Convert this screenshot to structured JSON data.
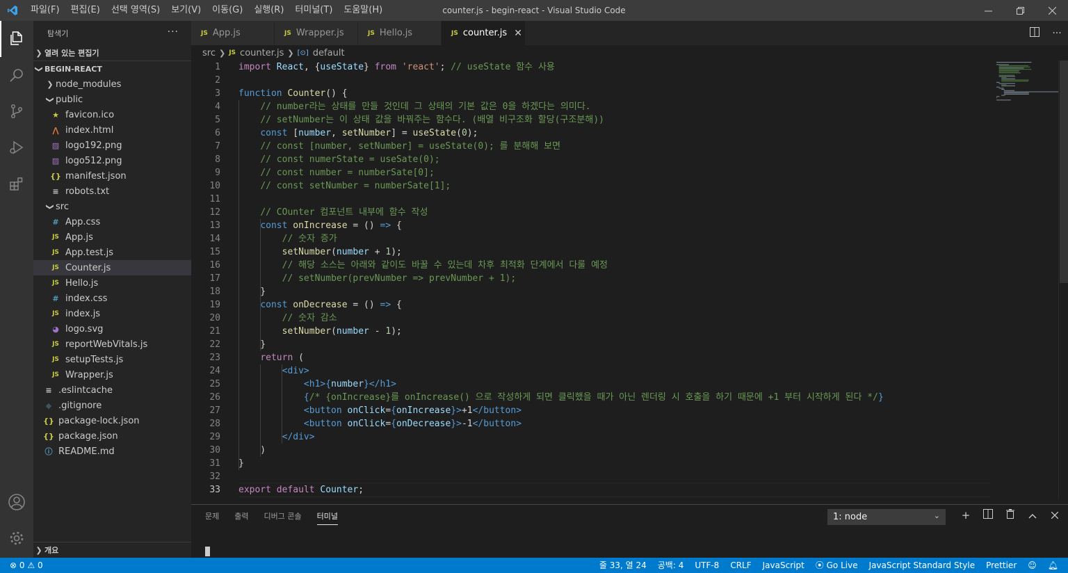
{
  "titlebar": {
    "menu": [
      "파일(F)",
      "편집(E)",
      "선택 영역(S)",
      "보기(V)",
      "이동(G)",
      "실행(R)",
      "터미널(T)",
      "도움말(H)"
    ],
    "title": "counter.js - begin-react - Visual Studio Code"
  },
  "sidebar": {
    "header": "탐색기",
    "open_editors": "열려 있는 편집기",
    "project": "BEGIN-REACT",
    "outline": "개요",
    "tree": [
      {
        "label": "node_modules",
        "type": "folder-closed",
        "depth": 1
      },
      {
        "label": "public",
        "type": "folder-open",
        "depth": 1
      },
      {
        "label": "favicon.ico",
        "type": "star",
        "depth": 2
      },
      {
        "label": "index.html",
        "type": "html",
        "depth": 2
      },
      {
        "label": "logo192.png",
        "type": "image",
        "depth": 2
      },
      {
        "label": "logo512.png",
        "type": "image",
        "depth": 2
      },
      {
        "label": "manifest.json",
        "type": "json",
        "depth": 2
      },
      {
        "label": "robots.txt",
        "type": "text",
        "depth": 2
      },
      {
        "label": "src",
        "type": "folder-open",
        "depth": 1
      },
      {
        "label": "App.css",
        "type": "css",
        "depth": 2
      },
      {
        "label": "App.js",
        "type": "js",
        "depth": 2
      },
      {
        "label": "App.test.js",
        "type": "js",
        "depth": 2
      },
      {
        "label": "Counter.js",
        "type": "js",
        "depth": 2,
        "selected": true
      },
      {
        "label": "Hello.js",
        "type": "js",
        "depth": 2
      },
      {
        "label": "index.css",
        "type": "css",
        "depth": 2
      },
      {
        "label": "index.js",
        "type": "js",
        "depth": 2
      },
      {
        "label": "logo.svg",
        "type": "svg",
        "depth": 2
      },
      {
        "label": "reportWebVitals.js",
        "type": "js",
        "depth": 2
      },
      {
        "label": "setupTests.js",
        "type": "js",
        "depth": 2
      },
      {
        "label": "Wrapper.js",
        "type": "js",
        "depth": 2
      },
      {
        "label": ".eslintcache",
        "type": "text",
        "depth": 1
      },
      {
        "label": ".gitignore",
        "type": "git",
        "depth": 1
      },
      {
        "label": "package-lock.json",
        "type": "json",
        "depth": 1
      },
      {
        "label": "package.json",
        "type": "json",
        "depth": 1
      },
      {
        "label": "README.md",
        "type": "info",
        "depth": 1
      }
    ]
  },
  "tabs": [
    {
      "label": "App.js",
      "active": false
    },
    {
      "label": "Wrapper.js",
      "active": false
    },
    {
      "label": "Hello.js",
      "active": false
    },
    {
      "label": "counter.js",
      "active": true
    }
  ],
  "breadcrumb": {
    "folder": "src",
    "file": "counter.js",
    "symbol": "default"
  },
  "editor": {
    "current_line": 33,
    "lines": [
      [
        [
          "k",
          "import"
        ],
        [
          "w",
          " "
        ],
        [
          "v",
          "React"
        ],
        [
          "w",
          ", {"
        ],
        [
          "v",
          "useState"
        ],
        [
          "w",
          "} "
        ],
        [
          "k",
          "from"
        ],
        [
          "w",
          " "
        ],
        [
          "s",
          "'react'"
        ],
        [
          "w",
          "; "
        ],
        [
          "c",
          "// useState 함수 사용"
        ]
      ],
      [],
      [
        [
          "kb",
          "function"
        ],
        [
          "w",
          " "
        ],
        [
          "f",
          "Counter"
        ],
        [
          "w",
          "() {"
        ]
      ],
      [
        [
          "w",
          "    "
        ],
        [
          "c",
          "// number라는 상태를 만들 것인데 그 상태의 기본 값은 0을 하겠다는 의미다."
        ]
      ],
      [
        [
          "w",
          "    "
        ],
        [
          "c",
          "// setNumber는 이 상태 값을 바꿔주는 함수다. (배열 비구조화 할당(구조분해))"
        ]
      ],
      [
        [
          "w",
          "    "
        ],
        [
          "kb",
          "const"
        ],
        [
          "w",
          " ["
        ],
        [
          "v",
          "number"
        ],
        [
          "w",
          ", "
        ],
        [
          "f",
          "setNumber"
        ],
        [
          "w",
          "] = "
        ],
        [
          "f",
          "useState"
        ],
        [
          "w",
          "("
        ],
        [
          "n",
          "0"
        ],
        [
          "w",
          ");"
        ]
      ],
      [
        [
          "w",
          "    "
        ],
        [
          "c",
          "// const [number, setNumber] = useState(0); 를 분해해 보면"
        ]
      ],
      [
        [
          "w",
          "    "
        ],
        [
          "c",
          "// const numerState = useSate(0);"
        ]
      ],
      [
        [
          "w",
          "    "
        ],
        [
          "c",
          "// const number = numberSate[0];"
        ]
      ],
      [
        [
          "w",
          "    "
        ],
        [
          "c",
          "// const setNumber = numberSate[1];"
        ]
      ],
      [],
      [
        [
          "w",
          "    "
        ],
        [
          "c",
          "// COunter 컴포넌트 내부에 함수 작성"
        ]
      ],
      [
        [
          "w",
          "    "
        ],
        [
          "kb",
          "const"
        ],
        [
          "w",
          " "
        ],
        [
          "f",
          "onIncrease"
        ],
        [
          "w",
          " = () "
        ],
        [
          "kb",
          "=>"
        ],
        [
          "w",
          " {"
        ]
      ],
      [
        [
          "w",
          "        "
        ],
        [
          "c",
          "// 숫자 증가"
        ]
      ],
      [
        [
          "w",
          "        "
        ],
        [
          "f",
          "setNumber"
        ],
        [
          "w",
          "("
        ],
        [
          "v",
          "number"
        ],
        [
          "w",
          " + "
        ],
        [
          "n",
          "1"
        ],
        [
          "w",
          ");"
        ]
      ],
      [
        [
          "w",
          "        "
        ],
        [
          "c",
          "// 해당 소스는 아래와 같이도 바꿀 수 있는데 차후 최적화 단계에서 다룰 예정"
        ]
      ],
      [
        [
          "w",
          "        "
        ],
        [
          "c",
          "// setNumber(prevNumber => prevNumber + 1);"
        ]
      ],
      [
        [
          "w",
          "    }"
        ]
      ],
      [
        [
          "w",
          "    "
        ],
        [
          "kb",
          "const"
        ],
        [
          "w",
          " "
        ],
        [
          "f",
          "onDecrease"
        ],
        [
          "w",
          " = () "
        ],
        [
          "kb",
          "=>"
        ],
        [
          "w",
          " {"
        ]
      ],
      [
        [
          "w",
          "        "
        ],
        [
          "c",
          "// 숫자 감소"
        ]
      ],
      [
        [
          "w",
          "        "
        ],
        [
          "f",
          "setNumber"
        ],
        [
          "w",
          "("
        ],
        [
          "v",
          "number"
        ],
        [
          "w",
          " - "
        ],
        [
          "n",
          "1"
        ],
        [
          "w",
          ");"
        ]
      ],
      [
        [
          "w",
          "    }"
        ]
      ],
      [
        [
          "w",
          "    "
        ],
        [
          "k",
          "return"
        ],
        [
          "w",
          " ("
        ]
      ],
      [
        [
          "w",
          "        "
        ],
        [
          "t",
          "<div>"
        ]
      ],
      [
        [
          "w",
          "            "
        ],
        [
          "t",
          "<h1>"
        ],
        [
          "kb",
          "{"
        ],
        [
          "v",
          "number"
        ],
        [
          "kb",
          "}"
        ],
        [
          "t",
          "</h1>"
        ]
      ],
      [
        [
          "w",
          "            "
        ],
        [
          "kb",
          "{"
        ],
        [
          "c",
          "/* {onIncrease}를 onIncrease() 으로 작성하게 되면 클릭했을 때가 아닌 렌더링 시 호출을 하기 때문에 +1 부터 시작하게 된다 */"
        ],
        [
          "kb",
          "}"
        ]
      ],
      [
        [
          "w",
          "            "
        ],
        [
          "t",
          "<button"
        ],
        [
          "w",
          " "
        ],
        [
          "v",
          "onClick"
        ],
        [
          "w",
          "="
        ],
        [
          "kb",
          "{"
        ],
        [
          "v",
          "onIncrease"
        ],
        [
          "kb",
          "}"
        ],
        [
          "t",
          ">"
        ],
        [
          "w",
          "+1"
        ],
        [
          "t",
          "</button>"
        ]
      ],
      [
        [
          "w",
          "            "
        ],
        [
          "t",
          "<button"
        ],
        [
          "w",
          " "
        ],
        [
          "v",
          "onClick"
        ],
        [
          "w",
          "="
        ],
        [
          "kb",
          "{"
        ],
        [
          "v",
          "onDecrease"
        ],
        [
          "kb",
          "}"
        ],
        [
          "t",
          ">"
        ],
        [
          "w",
          "-1"
        ],
        [
          "t",
          "</button>"
        ]
      ],
      [
        [
          "w",
          "        "
        ],
        [
          "t",
          "</div>"
        ]
      ],
      [
        [
          "w",
          "    )"
        ]
      ],
      [
        [
          "w",
          "}"
        ]
      ],
      [],
      [
        [
          "k",
          "export"
        ],
        [
          "w",
          " "
        ],
        [
          "k",
          "default"
        ],
        [
          "w",
          " "
        ],
        [
          "v",
          "Counter"
        ],
        [
          "w",
          ";"
        ]
      ]
    ]
  },
  "panel": {
    "tabs": [
      "문제",
      "출력",
      "디버그 콘솔",
      "터미널"
    ],
    "active_tab": "터미널",
    "terminal_select": "1: node"
  },
  "statusbar": {
    "errors": "0",
    "warnings": "0",
    "position": "줄 33, 열 24",
    "indent": "공백: 4",
    "encoding": "UTF-8",
    "eol": "CRLF",
    "language": "JavaScript",
    "golive": "Go Live",
    "style": "JavaScript Standard Style",
    "formatter": "Prettier"
  },
  "colors": {
    "accent": "#007acc",
    "editor_bg": "#1e1e1e",
    "sidebar_bg": "#252526",
    "activity_bg": "#333333"
  }
}
